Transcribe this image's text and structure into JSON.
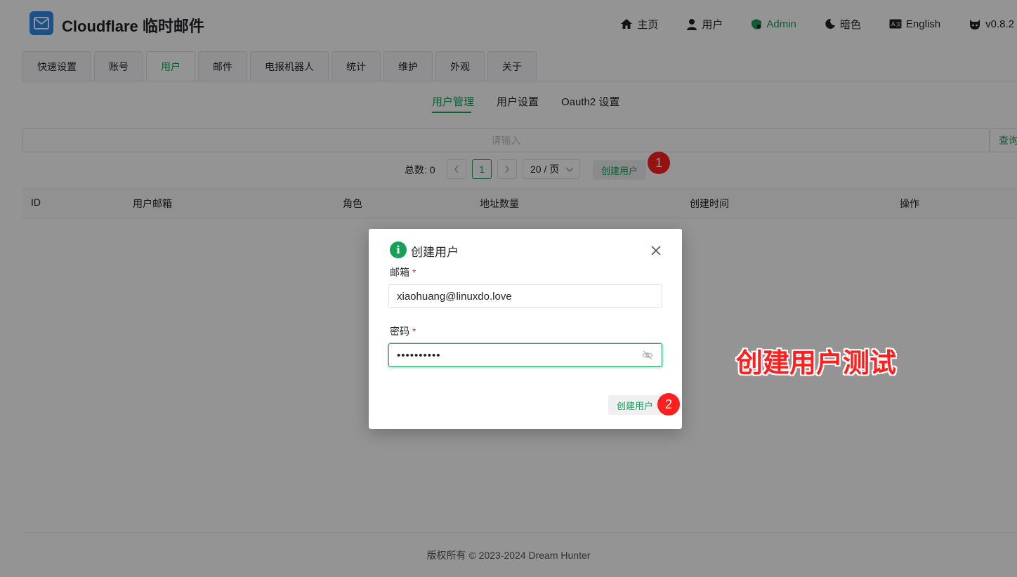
{
  "header": {
    "app_title": "Cloudflare 临时邮件",
    "logo_icon": "mail-icon",
    "nav": [
      {
        "icon": "home-icon",
        "label": "主页"
      },
      {
        "icon": "user-icon",
        "label": "用户"
      },
      {
        "icon": "shield-icon",
        "label": "Admin"
      },
      {
        "icon": "moon-icon",
        "label": "暗色"
      },
      {
        "icon": "translate-icon",
        "label": "English"
      },
      {
        "icon": "github-icon",
        "label": "v0.8.2"
      }
    ]
  },
  "tabs": [
    "快速设置",
    "账号",
    "用户",
    "邮件",
    "电报机器人",
    "统计",
    "维护",
    "外观",
    "关于"
  ],
  "active_tab": "用户",
  "subtabs": [
    "用户管理",
    "用户设置",
    "Oauth2 设置"
  ],
  "active_subtab": "用户管理",
  "search": {
    "placeholder": "请输入",
    "button": "查询"
  },
  "pagination": {
    "total_label": "总数: 0",
    "current_page": "1",
    "page_size": "20 / 页",
    "create_button": "创建用户"
  },
  "table": {
    "columns": [
      "ID",
      "用户邮箱",
      "角色",
      "地址数量",
      "创建时间",
      "操作"
    ]
  },
  "footer": "版权所有 © 2023-2024 Dream Hunter",
  "modal": {
    "title": "创建用户",
    "email_label": "邮箱",
    "email_value": "xiaohuang@linuxdo.love",
    "password_label": "密码",
    "password_value": "••••••••••",
    "submit": "创建用户",
    "required_mark": "*"
  },
  "markers": [
    "1",
    "2"
  ],
  "annotation": "创建用户测试",
  "colors": {
    "primary": "#18a058",
    "logo": "#2d8cf0",
    "marker": "#ff1f1f",
    "required": "#d03050"
  }
}
